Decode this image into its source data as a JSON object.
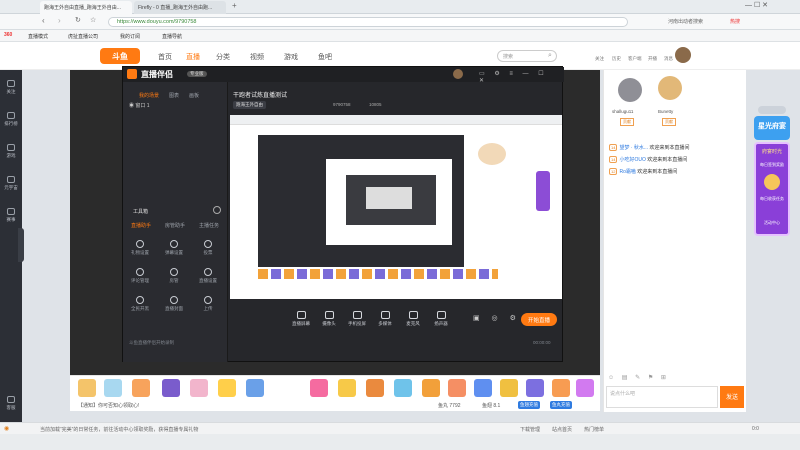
{
  "browser": {
    "tabs": [
      {
        "label": "跑海王外自由直播_跑海王外自由..."
      },
      {
        "label": "Firefly - 0 直播_跑海王外自由跑..."
      }
    ],
    "url": "https://www.douyu.com/9790758",
    "address_right": "河南出动者搜索",
    "hot_badge": "热搜",
    "bookmarks": [
      "直播模式",
      "虎扯直播公司",
      "我的订阅",
      "直播导航"
    ]
  },
  "site": {
    "logo": "斗鱼",
    "nav": [
      "首页",
      "直播",
      "分类",
      "视频",
      "游戏",
      "鱼吧"
    ],
    "search_placeholder": "搜索",
    "header_icons": [
      "关注",
      "历史",
      "客户端",
      "开播",
      "消息"
    ]
  },
  "sidebar": {
    "items": [
      "关注",
      "排行榜",
      "游戏",
      "元宇宙",
      "赛事",
      "客服"
    ]
  },
  "workbench": {
    "title": "直播伴侣",
    "version": "专业版",
    "stream_title": "干跑者试炼直播测试",
    "tag": "跑海王外自由",
    "room_id": "9790758",
    "heat": "10805",
    "left_tabs": [
      "我的场景",
      "图表",
      "画板"
    ],
    "scene_label": "窗口 1",
    "toolbox_label": "工具箱",
    "tool_tabs": [
      "直播助手",
      "房管助手",
      "主播任务"
    ],
    "tools": [
      "礼物设置",
      "弹幕设置",
      "投票",
      "评论管理",
      "房管",
      "直播设置",
      "全民开黑",
      "直播封面",
      "上传"
    ],
    "controls": [
      "直播屏幕",
      "摄像头",
      "手机投屏",
      "多媒体",
      "麦克风",
      "扬声器"
    ],
    "start_button": "开始直播",
    "status": "斗鱼直播伴侣开始录制",
    "timer": "00:00:00"
  },
  "chat": {
    "rank": [
      {
        "name": "shallugu11",
        "badge": "贡献"
      },
      {
        "name": "Bunetty",
        "badge": "贡献"
      }
    ],
    "messages": [
      {
        "badge": "14",
        "user": "望梦 · 秋水...",
        "text": "欢迎来到本直播间"
      },
      {
        "badge": "14",
        "user": "小吃好OUO",
        "text": "欢迎来到本直播间"
      },
      {
        "badge": "12",
        "user": "Ro霜嗑",
        "text": "欢迎来到本直播间"
      }
    ],
    "input_placeholder": "说点什么吧",
    "send_label": "发送"
  },
  "gift_bar": {
    "notice": "【通知】你可否知心领取心!",
    "stats": [
      "鱼丸 7792",
      "鱼翅 8.1",
      "鱼翅充值",
      "鱼丸充值"
    ]
  },
  "promo": {
    "title": "星光府宴",
    "subtitle": "府宴时光",
    "tasks": [
      "每日签到奖励",
      "每日收获任务",
      "活动中心"
    ]
  },
  "download": {
    "text": "当前加载“完美”的日常任务，前往活动中心领取奖励，获得直播专属礼物",
    "items": [
      "下载管理",
      "站点首页",
      "热门榜单",
      "0:0"
    ]
  },
  "colors": {
    "brand": "#ff7a12",
    "sidebar": "#2c2f36",
    "workbench": "#26272b"
  }
}
